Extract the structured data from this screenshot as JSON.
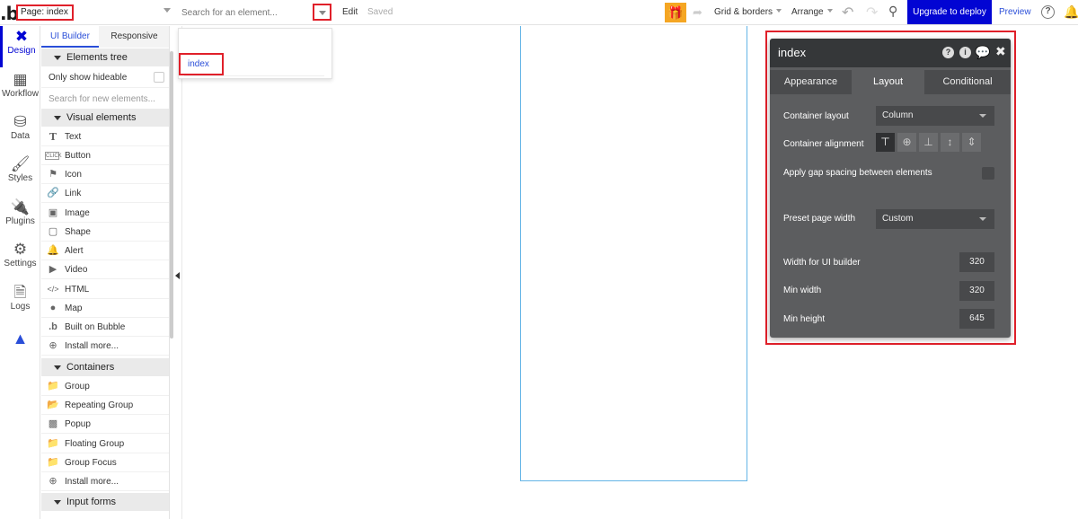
{
  "topbar": {
    "logo": ".b",
    "page_select": "Page: index",
    "search_placeholder": "Search for an element...",
    "edit_label": "Edit",
    "saved_label": "Saved",
    "grid_borders_label": "Grid & borders",
    "arrange_label": "Arrange",
    "upgrade_label": "Upgrade to deploy",
    "preview_label": "Preview",
    "help_label": "?"
  },
  "rail": {
    "items": [
      {
        "label": "Design",
        "icon": "design-icon"
      },
      {
        "label": "Workflow",
        "icon": "workflow-icon"
      },
      {
        "label": "Data",
        "icon": "data-icon"
      },
      {
        "label": "Styles",
        "icon": "styles-icon"
      },
      {
        "label": "Plugins",
        "icon": "plugins-icon"
      },
      {
        "label": "Settings",
        "icon": "settings-icon"
      },
      {
        "label": "Logs",
        "icon": "logs-icon"
      }
    ]
  },
  "panel": {
    "tabs": {
      "ui_builder": "UI Builder",
      "responsive": "Responsive"
    },
    "elements_tree": "Elements tree",
    "only_show_hideable": "Only show hideable",
    "search_new_placeholder": "Search for new elements...",
    "visual_elements": {
      "header": "Visual elements",
      "items": [
        "Text",
        "Button",
        "Icon",
        "Link",
        "Image",
        "Shape",
        "Alert",
        "Video",
        "HTML",
        "Map",
        "Built on Bubble",
        "Install more..."
      ]
    },
    "containers": {
      "header": "Containers",
      "items": [
        "Group",
        "Repeating Group",
        "Popup",
        "Floating Group",
        "Group Focus",
        "Install more..."
      ]
    },
    "input_forms": {
      "header": "Input forms"
    }
  },
  "dropdown": {
    "option": "index"
  },
  "property_editor": {
    "title": "index",
    "tabs": [
      "Appearance",
      "Layout",
      "Conditional"
    ],
    "active_tab": "Layout",
    "container_layout_label": "Container layout",
    "container_layout_value": "Column",
    "container_alignment_label": "Container alignment",
    "gap_label": "Apply gap spacing between elements",
    "preset_label": "Preset page width",
    "preset_value": "Custom",
    "width_ui_label": "Width for UI builder",
    "width_ui_value": "320",
    "min_width_label": "Min width",
    "min_width_value": "320",
    "min_height_label": "Min height",
    "min_height_value": "645"
  }
}
